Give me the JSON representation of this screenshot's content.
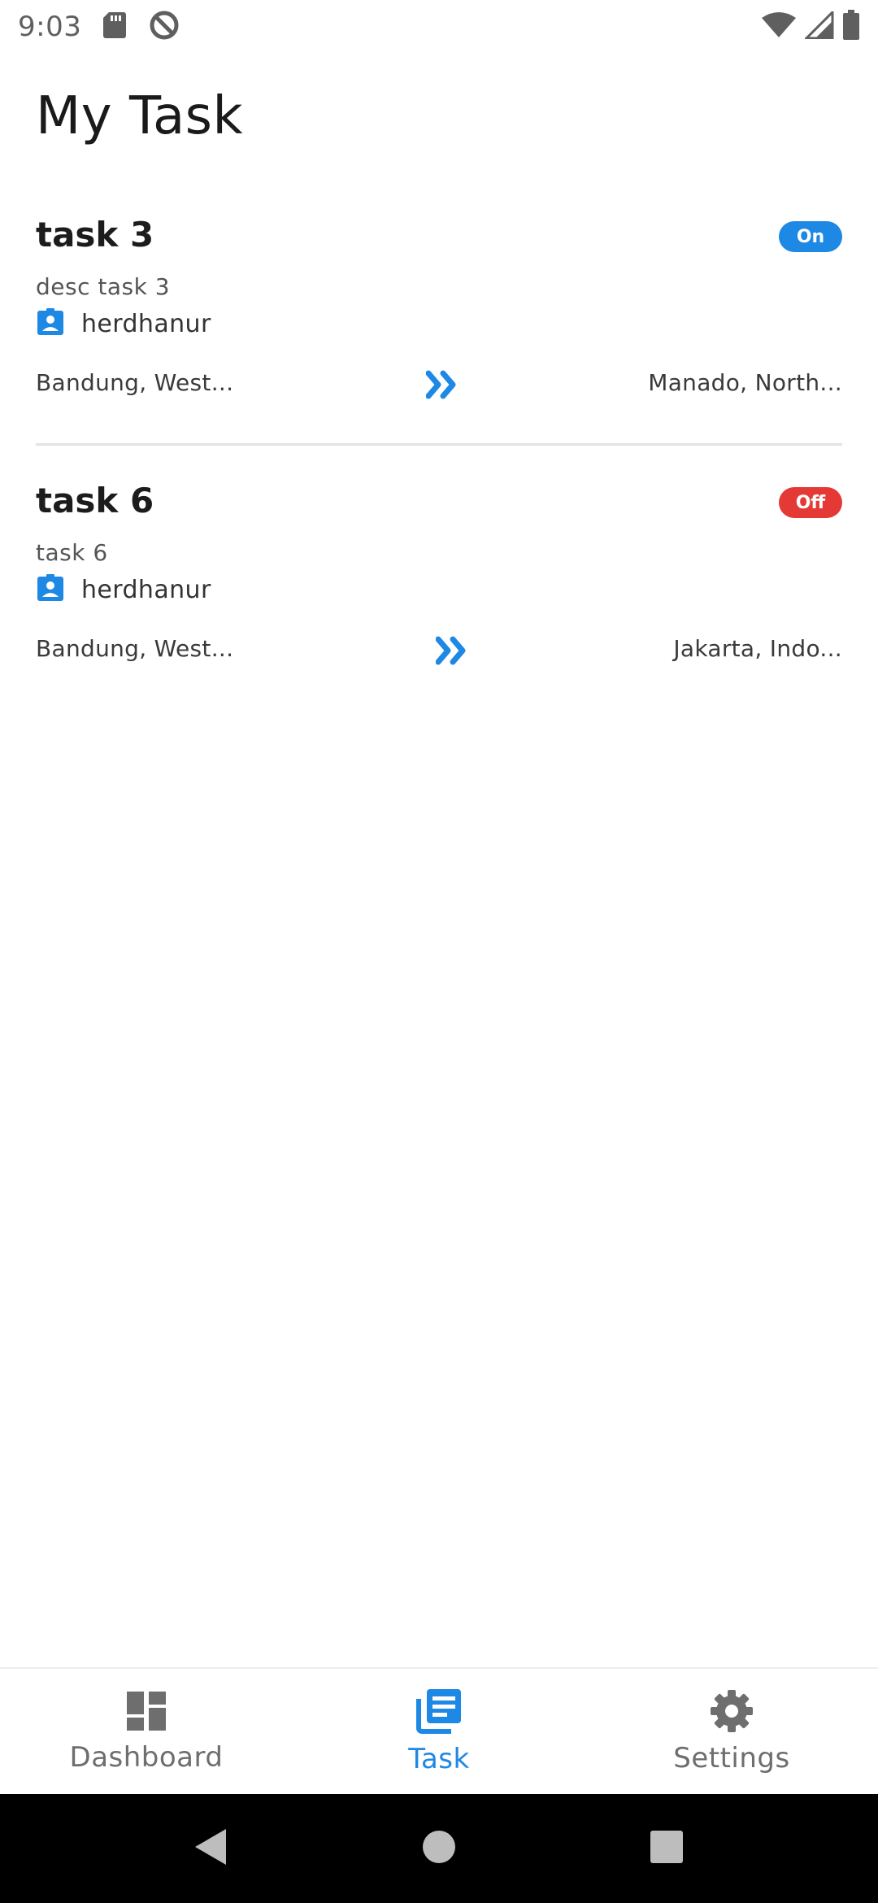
{
  "status_bar": {
    "time": "9:03",
    "icons_left": [
      "sd-card-icon",
      "no-sync-icon"
    ],
    "icons_right": [
      "wifi-icon",
      "cell-signal-icon",
      "battery-icon"
    ]
  },
  "header": {
    "title": "My Task"
  },
  "tasks": [
    {
      "title": "task 3",
      "status": "On",
      "status_color": "#1e88e5",
      "description": "desc task 3",
      "user": "herdhanur",
      "from": "Bandung, West...",
      "to": "Manado, North..."
    },
    {
      "title": "task 6",
      "status": "Off",
      "status_color": "#e53935",
      "description": "task 6",
      "user": "herdhanur",
      "from": "Bandung, West...",
      "to": "Jakarta, Indo..."
    }
  ],
  "bottom_nav": {
    "items": [
      {
        "label": "Dashboard",
        "icon": "dashboard-icon",
        "active": false
      },
      {
        "label": "Task",
        "icon": "task-list-icon",
        "active": true
      },
      {
        "label": "Settings",
        "icon": "gear-icon",
        "active": false
      }
    ]
  },
  "colors": {
    "accent": "#1e88e5",
    "off_badge": "#e53935",
    "inactive_nav": "#6e6e6e"
  }
}
